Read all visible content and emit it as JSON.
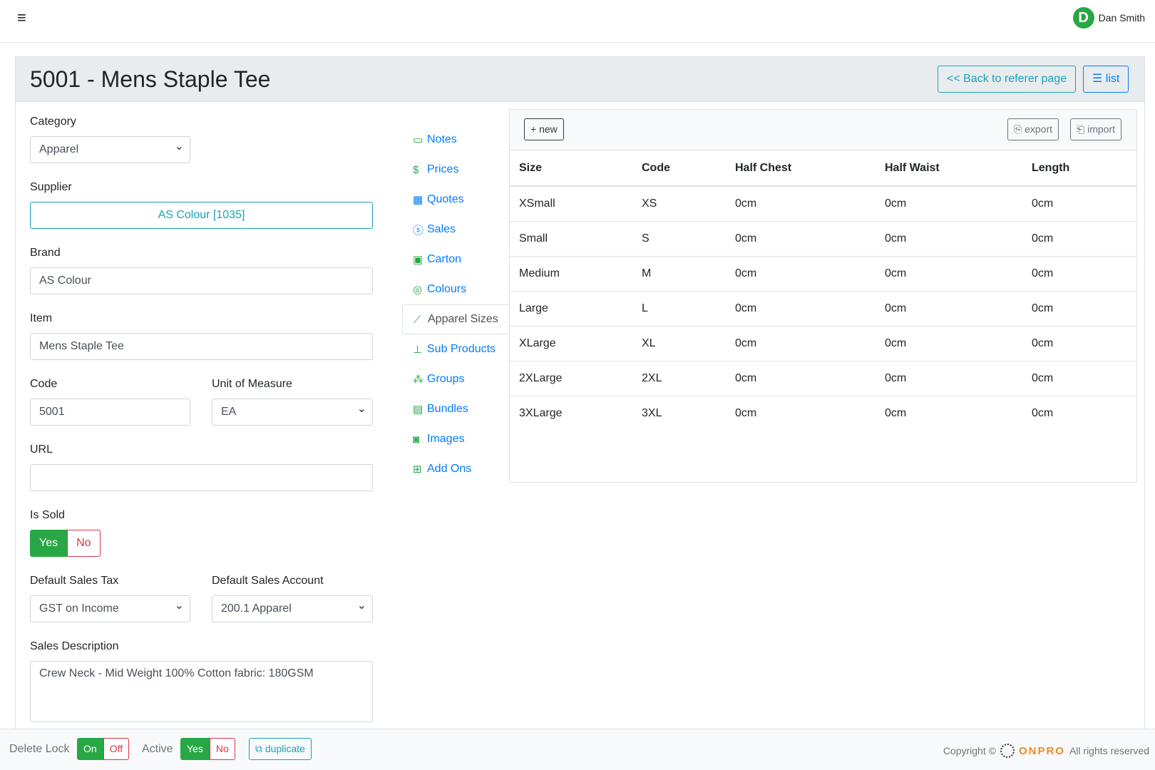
{
  "header": {
    "menu_icon": "≡",
    "user_initial": "D",
    "user_name": "Dan Smith"
  },
  "page": {
    "title": "5001 - Mens Staple Tee",
    "back_label": "<< Back to referer page",
    "list_label": "list"
  },
  "form": {
    "category_label": "Category",
    "category_value": "Apparel",
    "supplier_label": "Supplier",
    "supplier_value": "AS Colour [1035]",
    "brand_label": "Brand",
    "brand_value": "AS Colour",
    "item_label": "Item",
    "item_value": "Mens Staple Tee",
    "code_label": "Code",
    "code_value": "5001",
    "uom_label": "Unit of Measure",
    "uom_value": "EA",
    "url_label": "URL",
    "url_value": "",
    "is_sold_label": "Is Sold",
    "is_sold_yes": "Yes",
    "is_sold_no": "No",
    "sales_tax_label": "Default Sales Tax",
    "sales_tax_value": "GST on Income",
    "sales_account_label": "Default Sales Account",
    "sales_account_value": "200.1 Apparel",
    "sales_desc_label": "Sales Description",
    "sales_desc_value": "Crew Neck - Mid Weight 100% Cotton fabric: 180GSM"
  },
  "nav": [
    {
      "label": "Notes",
      "icon": "comment-icon"
    },
    {
      "label": "Prices",
      "icon": "dollar-icon"
    },
    {
      "label": "Quotes",
      "icon": "table-icon"
    },
    {
      "label": "Sales",
      "icon": "coin-icon"
    },
    {
      "label": "Carton",
      "icon": "box-icon"
    },
    {
      "label": "Colours",
      "icon": "palette-icon"
    },
    {
      "label": "Apparel Sizes",
      "icon": "ruler-icon",
      "active": true
    },
    {
      "label": "Sub Products",
      "icon": "sitemap-icon"
    },
    {
      "label": "Groups",
      "icon": "cubes-icon"
    },
    {
      "label": "Bundles",
      "icon": "images-icon"
    },
    {
      "label": "Images",
      "icon": "camera-icon"
    },
    {
      "label": "Add Ons",
      "icon": "plus-square-icon"
    }
  ],
  "sizes_panel": {
    "new_label": "new",
    "export_label": "export",
    "import_label": "import",
    "columns": [
      "Size",
      "Code",
      "Half Chest",
      "Half Waist",
      "Length"
    ],
    "rows": [
      [
        "XSmall",
        "XS",
        "0cm",
        "0cm",
        "0cm"
      ],
      [
        "Small",
        "S",
        "0cm",
        "0cm",
        "0cm"
      ],
      [
        "Medium",
        "M",
        "0cm",
        "0cm",
        "0cm"
      ],
      [
        "Large",
        "L",
        "0cm",
        "0cm",
        "0cm"
      ],
      [
        "XLarge",
        "XL",
        "0cm",
        "0cm",
        "0cm"
      ],
      [
        "2XLarge",
        "2XL",
        "0cm",
        "0cm",
        "0cm"
      ],
      [
        "3XLarge",
        "3XL",
        "0cm",
        "0cm",
        "0cm"
      ]
    ]
  },
  "footer": {
    "delete_lock_label": "Delete Lock",
    "on_label": "On",
    "off_label": "Off",
    "active_label": "Active",
    "yes_label": "Yes",
    "no_label": "No",
    "duplicate_label": "duplicate",
    "copyright_prefix": "Copyright ©",
    "brand": "ONPRO",
    "copyright_suffix": "All rights reserved"
  },
  "colors": {
    "primary": "#007bff",
    "info": "#17a2b8",
    "success": "#28a745",
    "danger": "#dc3545",
    "brand_orange": "#f08a24"
  }
}
